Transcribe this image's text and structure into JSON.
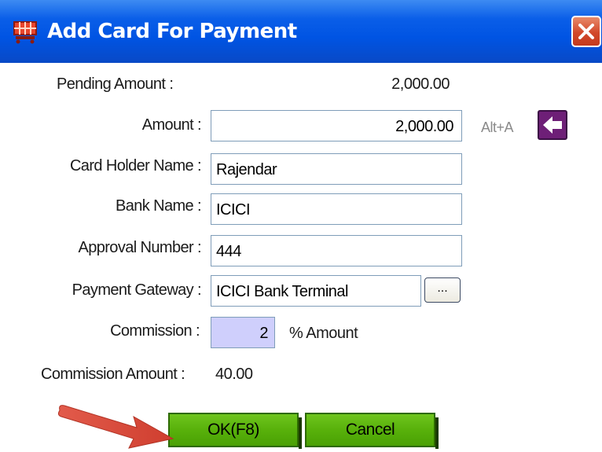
{
  "window": {
    "title": "Add Card For Payment"
  },
  "form": {
    "pending_amount_label": "Pending Amount :",
    "pending_amount_value": "2,000.00",
    "amount_label": "Amount :",
    "amount_value": "2,000.00",
    "card_holder_label": "Card Holder Name :",
    "card_holder_value": "Rajendar",
    "bank_name_label": "Bank Name :",
    "bank_name_value": "ICICI",
    "approval_number_label": "Approval Number :",
    "approval_number_value": "444",
    "payment_gateway_label": "Payment Gateway :",
    "payment_gateway_value": "ICICI Bank Terminal",
    "browse_label": "...",
    "commission_label": "Commission :",
    "commission_value": "2",
    "commission_unit": "% Amount",
    "commission_amount_label": "Commission Amount :",
    "commission_amount_value": "40.00",
    "shortcut_label": "Alt+A"
  },
  "buttons": {
    "ok_label": "OK(F8)",
    "cancel_label": "Cancel"
  },
  "colors": {
    "titlebar": "#0054e3",
    "close_button": "#d2482a",
    "button_green": "#58b10b",
    "commission_field_bg": "#cfcffc",
    "back_button": "#6e1f77",
    "annotation_arrow": "#d9473a"
  },
  "icons": {
    "title_icon": "shopping-cart-icon",
    "close_icon": "close-icon",
    "back_icon": "arrow-left-icon",
    "annotation": "arrow-right-icon"
  }
}
